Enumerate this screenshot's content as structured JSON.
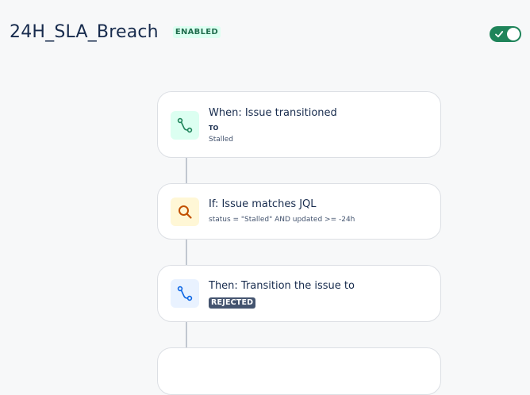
{
  "rule": {
    "title": "24H_SLA_Breach",
    "status_badge": "ENABLED",
    "enabled": true
  },
  "colors": {
    "toggle_on": "#1f845a",
    "trigger_icon_bg": "#dcfff1",
    "condition_icon_bg": "#fff7d6",
    "action_icon_bg": "#e9f2ff",
    "lozenge_bg": "#44546f"
  },
  "components": [
    {
      "kind": "trigger",
      "icon": "branch-icon",
      "title": "When: Issue transitioned",
      "label": "TO",
      "detail": "Stalled"
    },
    {
      "kind": "condition",
      "icon": "search-icon",
      "title": "If: Issue matches JQL",
      "detail": "status = \"Stalled\" AND updated >= -24h"
    },
    {
      "kind": "action",
      "icon": "transition-icon",
      "title": "Then: Transition the issue to",
      "lozenge": "REJECTED"
    }
  ]
}
